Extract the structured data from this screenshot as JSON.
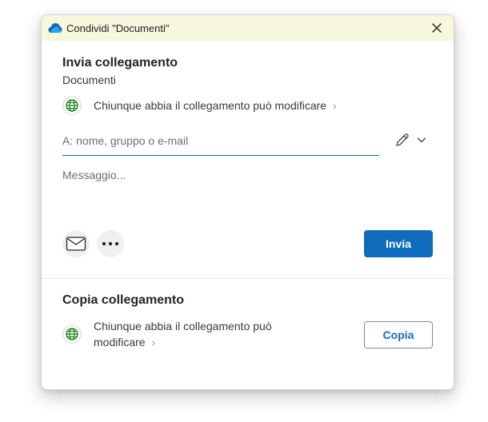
{
  "window": {
    "title": "Condividi \"Documenti\""
  },
  "send_section": {
    "heading": "Invia collegamento",
    "item_name": "Documenti",
    "permission": "Chiunque abbia il collegamento può modificare",
    "to_placeholder": "A: nome, gruppo o e-mail",
    "message_placeholder": "Messaggio...",
    "send_label": "Invia"
  },
  "copy_section": {
    "heading": "Copia collegamento",
    "permission_line1": "Chiunque abbia il collegamento può",
    "permission_line2": "modificare",
    "copy_label": "Copia"
  },
  "icons": {
    "cloud": "onedrive-cloud-icon",
    "close": "close-icon",
    "globe": "globe-icon",
    "pencil": "pencil-icon",
    "chevron_down": "chevron-down-icon",
    "chevron_right": "chevron-right-icon",
    "mail": "mail-icon",
    "more": "more-icon"
  },
  "colors": {
    "accent": "#0f6cbd",
    "titlebar": "#f6f7dd",
    "globe_green": "#107c10"
  }
}
